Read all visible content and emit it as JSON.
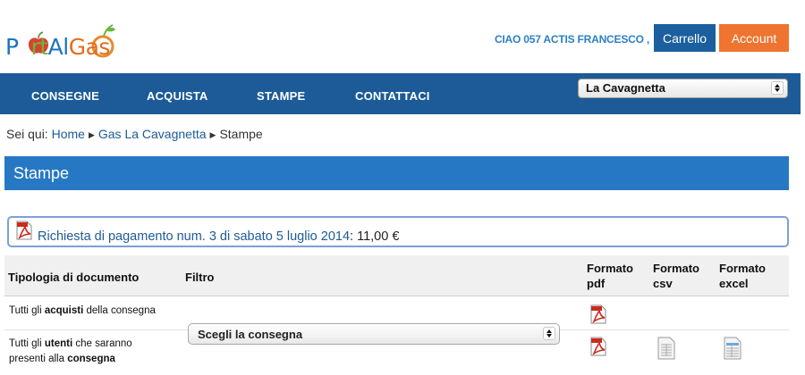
{
  "header": {
    "logo": {
      "part1": "P",
      "part2": "rt",
      "part3": "Al",
      "part4": "Gas"
    },
    "greeting": "CIAO 057 ACTIS FRANCESCO ,",
    "cart_label": "Carrello",
    "account_label": "Account"
  },
  "nav": {
    "items": [
      "CONSEGNE",
      "ACQUISTA",
      "STAMPE",
      "CONTATTACI"
    ],
    "gas_select_value": "La Cavagnetta"
  },
  "breadcrumb": {
    "prefix": "Sei qui:",
    "items": [
      "Home",
      "Gas La Cavagnetta",
      "Stampe"
    ]
  },
  "page_title": "Stampe",
  "payment": {
    "link_text": "Richiesta di pagamento num. 3 di sabato 5 luglio 2014",
    "amount": ": 11,00 €"
  },
  "table": {
    "headers": {
      "tipologia": "Tipologia di documento",
      "filtro": "Filtro",
      "pdf_line1": "Formato",
      "pdf_line2": "pdf",
      "csv_line1": "Formato",
      "csv_line2": "csv",
      "excel_line1": "Formato",
      "excel_line2": "excel"
    },
    "filter_select_value": "Scegli la consegna",
    "rows": [
      {
        "pre": "Tutti gli ",
        "bold": "acquisti",
        "post": " della consegna"
      },
      {
        "pre": "Tutti gli ",
        "bold": "utenti",
        "post": " che saranno",
        "line2_pre": "presenti alla ",
        "line2_bold": "consegna"
      }
    ]
  },
  "colors": {
    "nav_bg": "#1c5b97",
    "title_bg": "#2778c4",
    "cart_bg": "#1b5f9f",
    "account_bg": "#ee7430",
    "link": "#1c5b97"
  }
}
